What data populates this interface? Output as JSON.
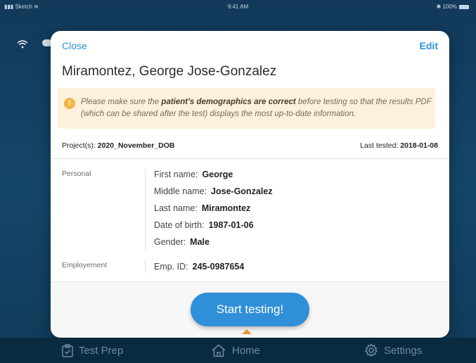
{
  "status_bar": {
    "carrier": "Sketch",
    "time": "9:41 AM",
    "battery": "100%"
  },
  "modal": {
    "close_label": "Close",
    "edit_label": "Edit",
    "patient_name": "Miramontez, George Jose-Gonzalez",
    "warning": {
      "prefix": "Please make sure the ",
      "emphasis": "patient's demographics are correct",
      "suffix": " before testing so that the results PDF (which can be shared after the test) displays the most up-to-date information."
    },
    "projects_label": "Project(s):",
    "projects_value": "2020_November_DOB",
    "last_tested_label": "Last tested:",
    "last_tested_value": "2018-01-08",
    "sections": {
      "personal": {
        "label": "Personal",
        "fields": [
          {
            "label": "First name:",
            "value": "George"
          },
          {
            "label": "Middle name:",
            "value": "Jose-Gonzalez"
          },
          {
            "label": "Last name:",
            "value": "Miramontez"
          },
          {
            "label": "Date of birth:",
            "value": "1987-01-06"
          },
          {
            "label": "Gender:",
            "value": "Male"
          }
        ]
      },
      "employment": {
        "label": "Employement",
        "fields": [
          {
            "label": "Emp. ID:",
            "value": "245-0987654"
          }
        ]
      }
    },
    "start_button": "Start testing!"
  },
  "tab_bar": {
    "tabs": [
      {
        "label": "Test Prep",
        "icon": "clipboard-check-icon"
      },
      {
        "label": "Home",
        "icon": "home-icon",
        "active": true
      },
      {
        "label": "Settings",
        "icon": "gear-icon"
      }
    ]
  },
  "colors": {
    "accent": "#2f8fd8",
    "warning_bg": "#fdf1dc",
    "warning_icon": "#f4b544",
    "background": "#12395a"
  }
}
